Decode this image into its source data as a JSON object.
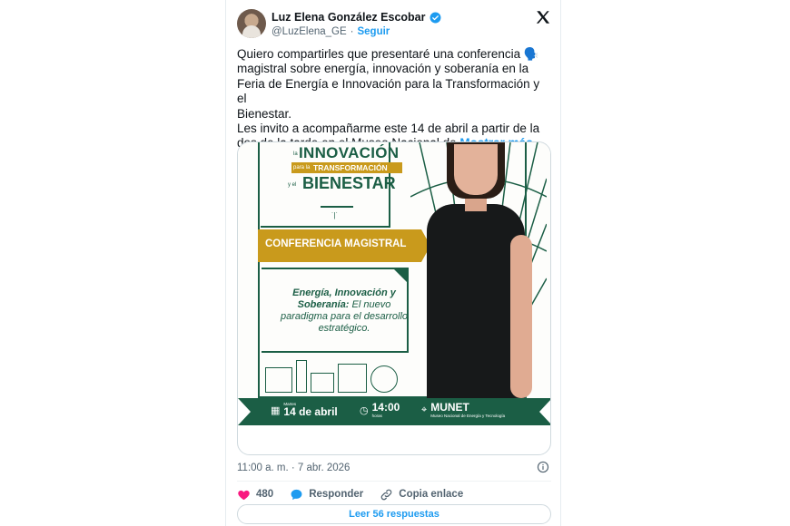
{
  "tweet": {
    "author_name": "Luz Elena González Escobar",
    "handle": "@LuzElena_GE",
    "dot": "·",
    "follow_label": "Seguir",
    "text_lines": [
      "Quiero compartirles que presentaré una conferencia 🗣️",
      "magistral sobre energía, innovación y soberanía en la",
      "Feria de Energía e Innovación para la Transformación y el",
      "Bienestar.",
      "Les invito a acompañarme este 14 de abril a partir de la",
      "dos de la tarde en el Museo Nacional de"
    ],
    "show_more": "Mostrar más",
    "timestamp": "11:00 a. m. · 7 abr. 2026",
    "likes": "480",
    "reply_label": "Responder",
    "copy_link_label": "Copia enlace",
    "read_replies": "Leer 56 respuestas"
  },
  "poster": {
    "pre_innovacion": "la",
    "innovacion": "INNOVACIÓN",
    "para_la": "para la",
    "transformacion": "TRANSFORMACIÓN",
    "y_el": "y el",
    "bienestar": "BIENESTAR",
    "conferencia": "CONFERENCIA MAGISTRAL",
    "desc_bold": "Energía, Innovación y Soberanía:",
    "desc_rest": "El nuevo paradigma para el desarrollo estratégico.",
    "day_label": "Martes",
    "date": "14 de abril",
    "time": "14:00",
    "time_label": "horas",
    "venue": "MUNET",
    "venue_sub": "Museo Nacional de Energía y Tecnología"
  },
  "colors": {
    "brand_green": "#1b5e45",
    "gold": "#c99a1c",
    "link_blue": "#1d9bf0",
    "like_pink": "#f91880"
  }
}
